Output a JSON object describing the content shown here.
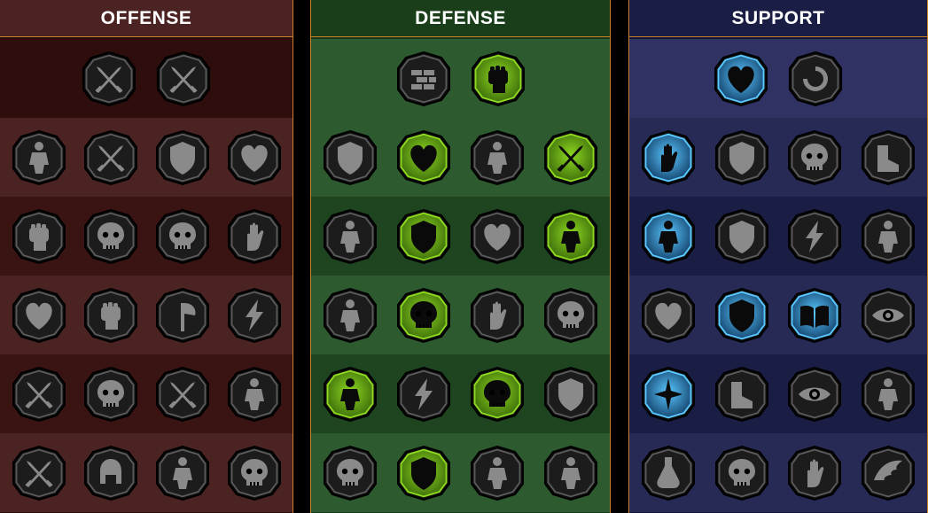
{
  "columns": [
    {
      "key": "offense",
      "title": "OFFENSE",
      "colors": {
        "bg": "#2b0d0c",
        "row_a": "#3a1413",
        "row_b": "#4b2322",
        "top_row": "#2e0e0c",
        "header_bg": "#4a2322",
        "border": "#c9822a"
      },
      "top_row": [
        {
          "icon": "crossed-swords-sparkle-icon",
          "state": "inactive"
        },
        {
          "icon": "slashing-blades-icon",
          "state": "inactive"
        }
      ],
      "rows": [
        [
          {
            "icon": "horned-demon-icon",
            "state": "inactive"
          },
          {
            "icon": "sword-strike-icon",
            "state": "inactive"
          },
          {
            "icon": "shield-arrows-icon",
            "state": "inactive"
          },
          {
            "icon": "broken-heart-icon",
            "state": "inactive"
          }
        ],
        [
          {
            "icon": "fist-impact-icon",
            "state": "inactive"
          },
          {
            "icon": "monster-jaws-icon",
            "state": "inactive"
          },
          {
            "icon": "skull-burst-icon",
            "state": "inactive"
          },
          {
            "icon": "grabbing-hand-icon",
            "state": "inactive"
          }
        ],
        [
          {
            "icon": "sword-heart-icon",
            "state": "inactive"
          },
          {
            "icon": "fist-hammer-icon",
            "state": "inactive"
          },
          {
            "icon": "axe-icon",
            "state": "inactive"
          },
          {
            "icon": "lightning-chains-icon",
            "state": "inactive"
          }
        ],
        [
          {
            "icon": "explosion-blades-icon",
            "state": "inactive"
          },
          {
            "icon": "skull-pile-icon",
            "state": "inactive"
          },
          {
            "icon": "dagger-circle-icon",
            "state": "inactive"
          },
          {
            "icon": "flexing-warrior-icon",
            "state": "inactive"
          }
        ],
        [
          {
            "icon": "sparkle-swords-icon",
            "state": "inactive"
          },
          {
            "icon": "knight-helmet-icon",
            "state": "inactive"
          },
          {
            "icon": "horned-beast-icon",
            "state": "inactive"
          },
          {
            "icon": "crowned-skull-icon",
            "state": "inactive"
          }
        ]
      ]
    },
    {
      "key": "defense",
      "title": "DEFENSE",
      "colors": {
        "bg": "#163a16",
        "row_a": "#1f4520",
        "row_b": "#2e5a2f",
        "top_row": "#2e5a2f",
        "header_bg": "#1a3e1a",
        "border": "#c9822a",
        "active": "#8ed820",
        "active_dark": "#3b6a0a"
      },
      "top_row": [
        {
          "icon": "brick-wall-icon",
          "state": "inactive"
        },
        {
          "icon": "raised-fist-icon",
          "state": "active"
        }
      ],
      "rows": [
        [
          {
            "icon": "layered-shield-icon",
            "state": "inactive"
          },
          {
            "icon": "heart-vial-icon",
            "state": "active"
          },
          {
            "icon": "muscular-warrior-icon",
            "state": "inactive"
          },
          {
            "icon": "crossed-blades-icon",
            "state": "active"
          }
        ],
        [
          {
            "icon": "deflect-figure-icon",
            "state": "inactive"
          },
          {
            "icon": "knight-shield-icon",
            "state": "active"
          },
          {
            "icon": "heart-icon",
            "state": "inactive"
          },
          {
            "icon": "aura-warrior-icon",
            "state": "active"
          }
        ],
        [
          {
            "icon": "crowd-icon",
            "state": "inactive"
          },
          {
            "icon": "hourglass-skull-icon",
            "state": "active"
          },
          {
            "icon": "open-palm-icon",
            "state": "inactive"
          },
          {
            "icon": "bull-head-icon",
            "state": "inactive"
          }
        ],
        [
          {
            "icon": "dashing-runner-icon",
            "state": "active"
          },
          {
            "icon": "claw-spikes-icon",
            "state": "inactive"
          },
          {
            "icon": "radiant-skull-icon",
            "state": "active"
          },
          {
            "icon": "spinning-shield-icon",
            "state": "inactive"
          }
        ],
        [
          {
            "icon": "armored-skull-icon",
            "state": "inactive"
          },
          {
            "icon": "winged-shield-icon",
            "state": "active"
          },
          {
            "icon": "bearded-warrior-icon",
            "state": "inactive"
          },
          {
            "icon": "strong-man-icon",
            "state": "inactive"
          }
        ]
      ]
    },
    {
      "key": "support",
      "title": "SUPPORT",
      "colors": {
        "bg": "#131538",
        "row_a": "#1a1d44",
        "row_b": "#262a55",
        "top_row": "#2f3263",
        "header_bg": "#1b1e44",
        "border": "#c9822a",
        "active": "#5ac8ff",
        "active_dark": "#12406a"
      },
      "top_row": [
        {
          "icon": "heart-sparkle-icon",
          "state": "active"
        },
        {
          "icon": "spiral-arrows-icon",
          "state": "inactive"
        }
      ],
      "rows": [
        [
          {
            "icon": "praying-hands-icon",
            "state": "active"
          },
          {
            "icon": "shield-rings-icon",
            "state": "inactive"
          },
          {
            "icon": "flaming-skull-icon",
            "state": "inactive"
          },
          {
            "icon": "speeding-boot-icon",
            "state": "inactive"
          }
        ],
        [
          {
            "icon": "blessing-figure-icon",
            "state": "active"
          },
          {
            "icon": "lightning-shield-icon",
            "state": "inactive"
          },
          {
            "icon": "cracked-ground-icon",
            "state": "inactive"
          },
          {
            "icon": "shadow-figures-icon",
            "state": "inactive"
          }
        ],
        [
          {
            "icon": "chained-heart-icon",
            "state": "inactive"
          },
          {
            "icon": "comet-shield-icon",
            "state": "active"
          },
          {
            "icon": "open-book-icon",
            "state": "active"
          },
          {
            "icon": "angry-eyes-icon",
            "state": "inactive"
          }
        ],
        [
          {
            "icon": "compass-star-icon",
            "state": "active"
          },
          {
            "icon": "winged-boot-icon",
            "state": "inactive"
          },
          {
            "icon": "all-seeing-eye-icon",
            "state": "inactive"
          },
          {
            "icon": "skeleton-banner-icon",
            "state": "inactive"
          }
        ],
        [
          {
            "icon": "poison-flask-icon",
            "state": "inactive"
          },
          {
            "icon": "screaming-skull-icon",
            "state": "inactive"
          },
          {
            "icon": "gripping-hand-icon",
            "state": "inactive"
          },
          {
            "icon": "eagle-head-icon",
            "state": "inactive"
          }
        ]
      ]
    }
  ]
}
